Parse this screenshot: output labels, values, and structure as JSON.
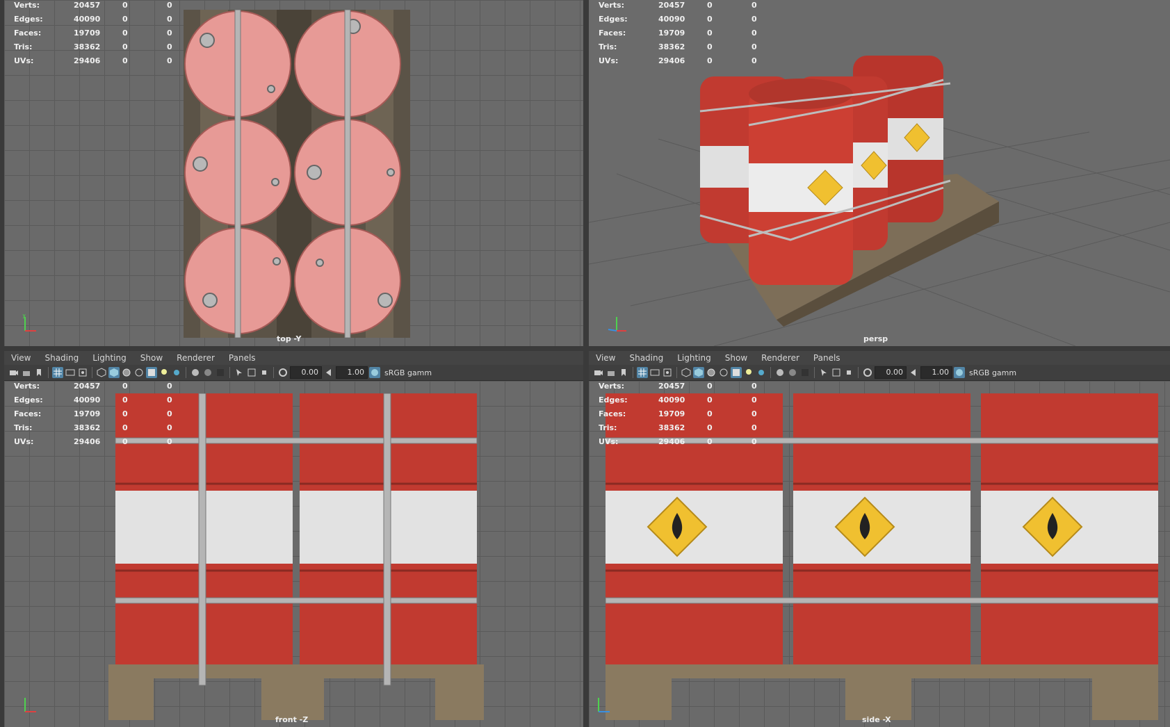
{
  "menu": [
    "View",
    "Shading",
    "Lighting",
    "Show",
    "Renderer",
    "Panels"
  ],
  "toolbar": {
    "field_a": "0.00",
    "field_b": "1.00",
    "color_mgmt": "sRGB gamm"
  },
  "stats": {
    "labels": [
      "Verts:",
      "Edges:",
      "Faces:",
      "Tris:",
      "UVs:"
    ],
    "values": [
      "20457",
      "40090",
      "19709",
      "38362",
      "29406"
    ],
    "zeros": [
      "0",
      "0"
    ]
  },
  "viewports": {
    "top": {
      "label": "top -Y"
    },
    "persp": {
      "label": "persp"
    },
    "front": {
      "label": "front -Z"
    },
    "side": {
      "label": "side -X"
    }
  },
  "colors": {
    "barrel_red": "#c13a30",
    "barrel_white": "#e6e6e6",
    "hazard": "#f0c030",
    "pallet": "#8a7a60",
    "ui_bg": "#444444",
    "accent": "#5285a6"
  }
}
